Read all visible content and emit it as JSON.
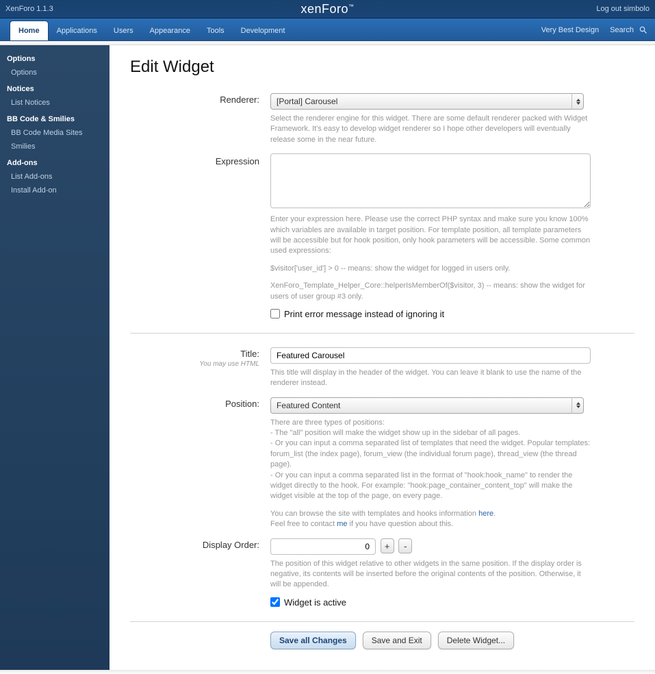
{
  "topbar": {
    "brand": "XenForo 1.1.3",
    "logo": "xenForo",
    "logout": "Log out simbolo"
  },
  "nav": {
    "tabs": [
      {
        "label": "Home",
        "active": true
      },
      {
        "label": "Applications",
        "active": false
      },
      {
        "label": "Users",
        "active": false
      },
      {
        "label": "Appearance",
        "active": false
      },
      {
        "label": "Tools",
        "active": false
      },
      {
        "label": "Development",
        "active": false
      }
    ],
    "right": {
      "design": "Very Best Design",
      "search": "Search"
    }
  },
  "sidebar": [
    {
      "title": "Options",
      "items": [
        "Options"
      ]
    },
    {
      "title": "Notices",
      "items": [
        "List Notices"
      ]
    },
    {
      "title": "BB Code & Smilies",
      "items": [
        "BB Code Media Sites",
        "Smilies"
      ]
    },
    {
      "title": "Add-ons",
      "items": [
        "List Add-ons",
        "Install Add-on"
      ]
    }
  ],
  "page": {
    "title": "Edit Widget",
    "renderer": {
      "label": "Renderer:",
      "value": "[Portal] Carousel",
      "desc": "Select the renderer engine for this widget. There are some default renderer packed with Widget Framework. It's easy to develop widget renderer so I hope other developers will eventually release some in the near future."
    },
    "expression": {
      "label": "Expression",
      "value": "",
      "desc1": "Enter your expression here. Please use the correct PHP syntax and make sure you know 100% which variables are available in target position. For template position, all template parameters will be accessible but for hook position, only hook parameters will be accessible. Some common used expressions:",
      "desc2": "$visitor['user_id'] > 0 -- means: show the widget for logged in users only.",
      "desc3": "XenForo_Template_Helper_Core::helperIsMemberOf($visitor, 3) -- means: show the widget for users of user group #3 only.",
      "checkbox": "Print error message instead of ignoring it"
    },
    "title_field": {
      "label": "Title:",
      "hint": "You may use HTML",
      "value": "Featured Carousel",
      "desc": "This title will display in the header of the widget. You can leave it blank to use the name of the renderer instead."
    },
    "position": {
      "label": "Position:",
      "value": "Featured Content",
      "desc1": "There are three types of positions:",
      "desc2": "- The \"all\" position will make the widget show up in the sidebar of all pages.",
      "desc3": "- Or you can input a comma separated list of templates that need the widget. Popular templates: forum_list (the index page), forum_view (the individual forum page), thread_view (the thread page).",
      "desc4": "- Or you can input a comma separated list in the format of \"hook:hook_name\" to render the widget directly to the hook. For example: \"hook:page_container_content_top\" will make the widget visible at the top of the page, on every page.",
      "desc5a": "You can browse the site with templates and hooks information ",
      "desc5_link": "here",
      "desc5b": ".",
      "desc6a": "Feel free to contact ",
      "desc6_link": "me",
      "desc6b": " if you have question about this."
    },
    "display_order": {
      "label": "Display Order:",
      "value": "0",
      "plus": "+",
      "minus": "-",
      "desc": "The position of this widget relative to other widgets in the same position. If the display order is negative, its contents will be inserted before the original contents of the position. Otherwise, it will be appended.",
      "active": "Widget is active"
    },
    "buttons": {
      "save_all": "Save all Changes",
      "save_exit": "Save and Exit",
      "delete": "Delete Widget..."
    }
  }
}
